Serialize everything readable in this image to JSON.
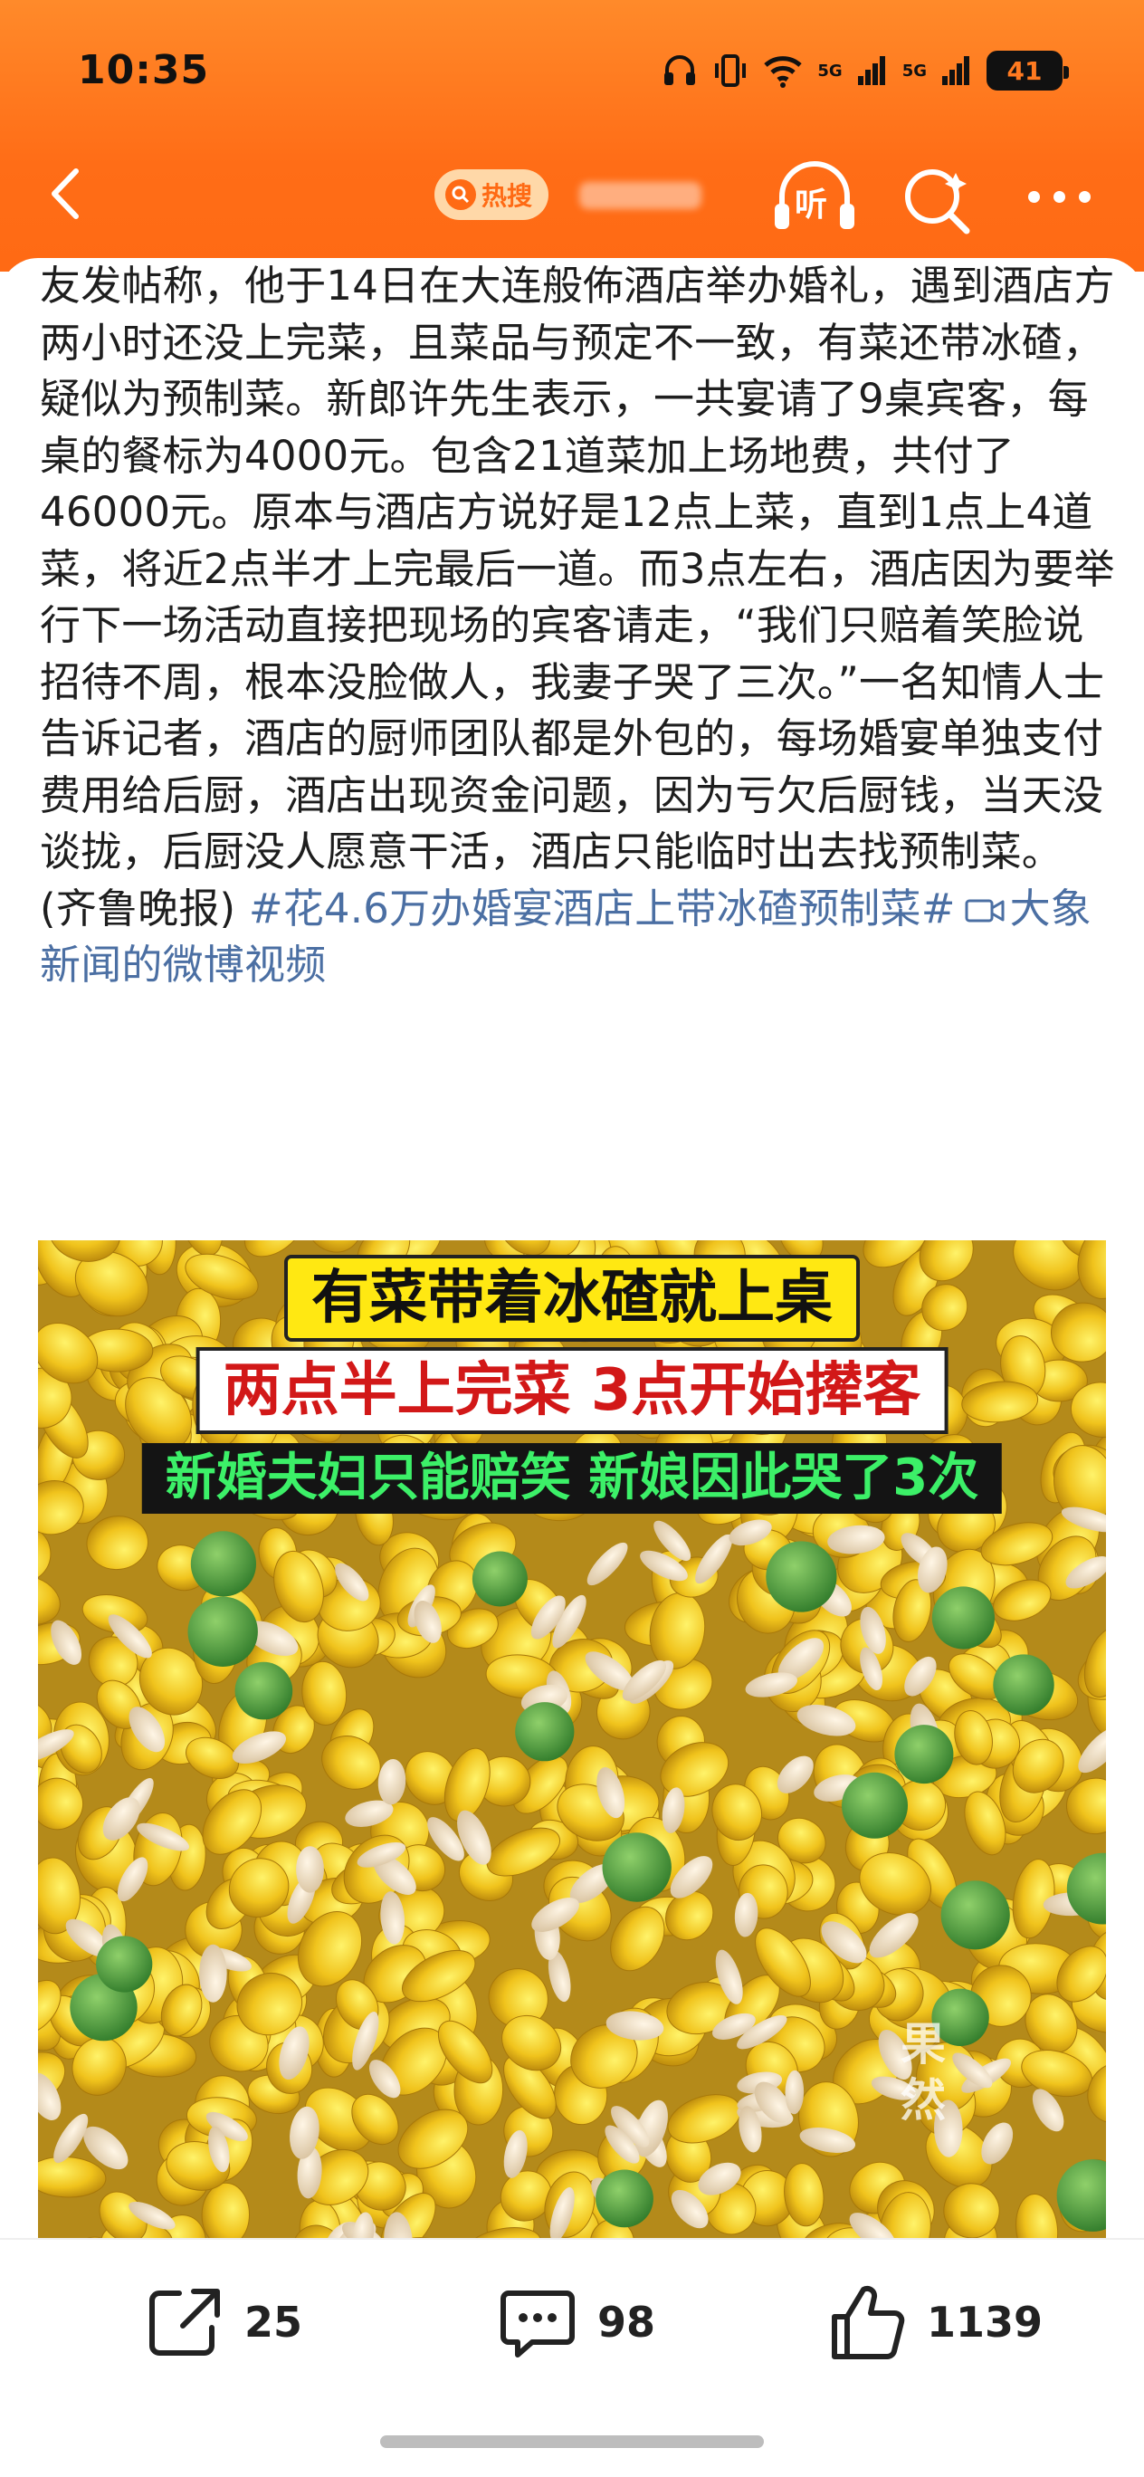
{
  "status_bar": {
    "time": "10:35",
    "network_1": "5G",
    "network_2": "5G",
    "battery": "41",
    "icons": [
      "headphones-icon",
      "vibrate-icon",
      "wifi-icon",
      "signal-icon",
      "signal-icon",
      "battery-icon"
    ]
  },
  "nav": {
    "back_icon": "chevron-left-icon",
    "hot_badge": "热搜",
    "listen_label": "听",
    "search_icon": "search-icon",
    "more_icon": "more-dots-icon"
  },
  "post": {
    "body": "友发帖称，他于14日在大连般佈酒店举办婚礼，遇到酒店方两小时还没上完菜，且菜品与预定不一致，有菜还带冰碴，疑似为预制菜。新郎许先生表示，一共宴请了9桌宾客，每桌的餐标为4000元。包含21道菜加上场地费，共付了46000元。原本与酒店方说好是12点上菜，直到1点上4道菜，将近2点半才上完最后一道。而3点左右，酒店因为要举行下一场活动直接把现场的宾客请走，“我们只赔着笑脸说招待不周，根本没脸做人，我妻子哭了三次。”一名知情人士告诉记者，酒店的厨师团队都是外包的，每场婚宴单独支付费用给后厨，酒店出现资金问题，因为亏欠后厨钱，当天没谈拢，后厨没人愿意干活，酒店只能临时出去找预制菜。(齐鲁晚报) ",
    "hashtag": "#花4.6万办婚宴酒店上带冰碴预制菜#",
    "video_link": "大象新闻的微博视频"
  },
  "image": {
    "caption_1": "有菜带着冰碴就上桌",
    "caption_2": "两点半上完菜 3点开始撵客",
    "caption_3": "新婚夫妇只能赔笑 新娘因此哭了3次",
    "watermark": "果然"
  },
  "actions": {
    "share_count": "25",
    "comment_count": "98",
    "like_count": "1139"
  },
  "colors": {
    "header_orange": "#ff6d17",
    "link_blue": "#4b6fa3",
    "caption_yellow": "#ffe812",
    "caption_red": "#d21818",
    "caption_green": "#3cf068"
  }
}
